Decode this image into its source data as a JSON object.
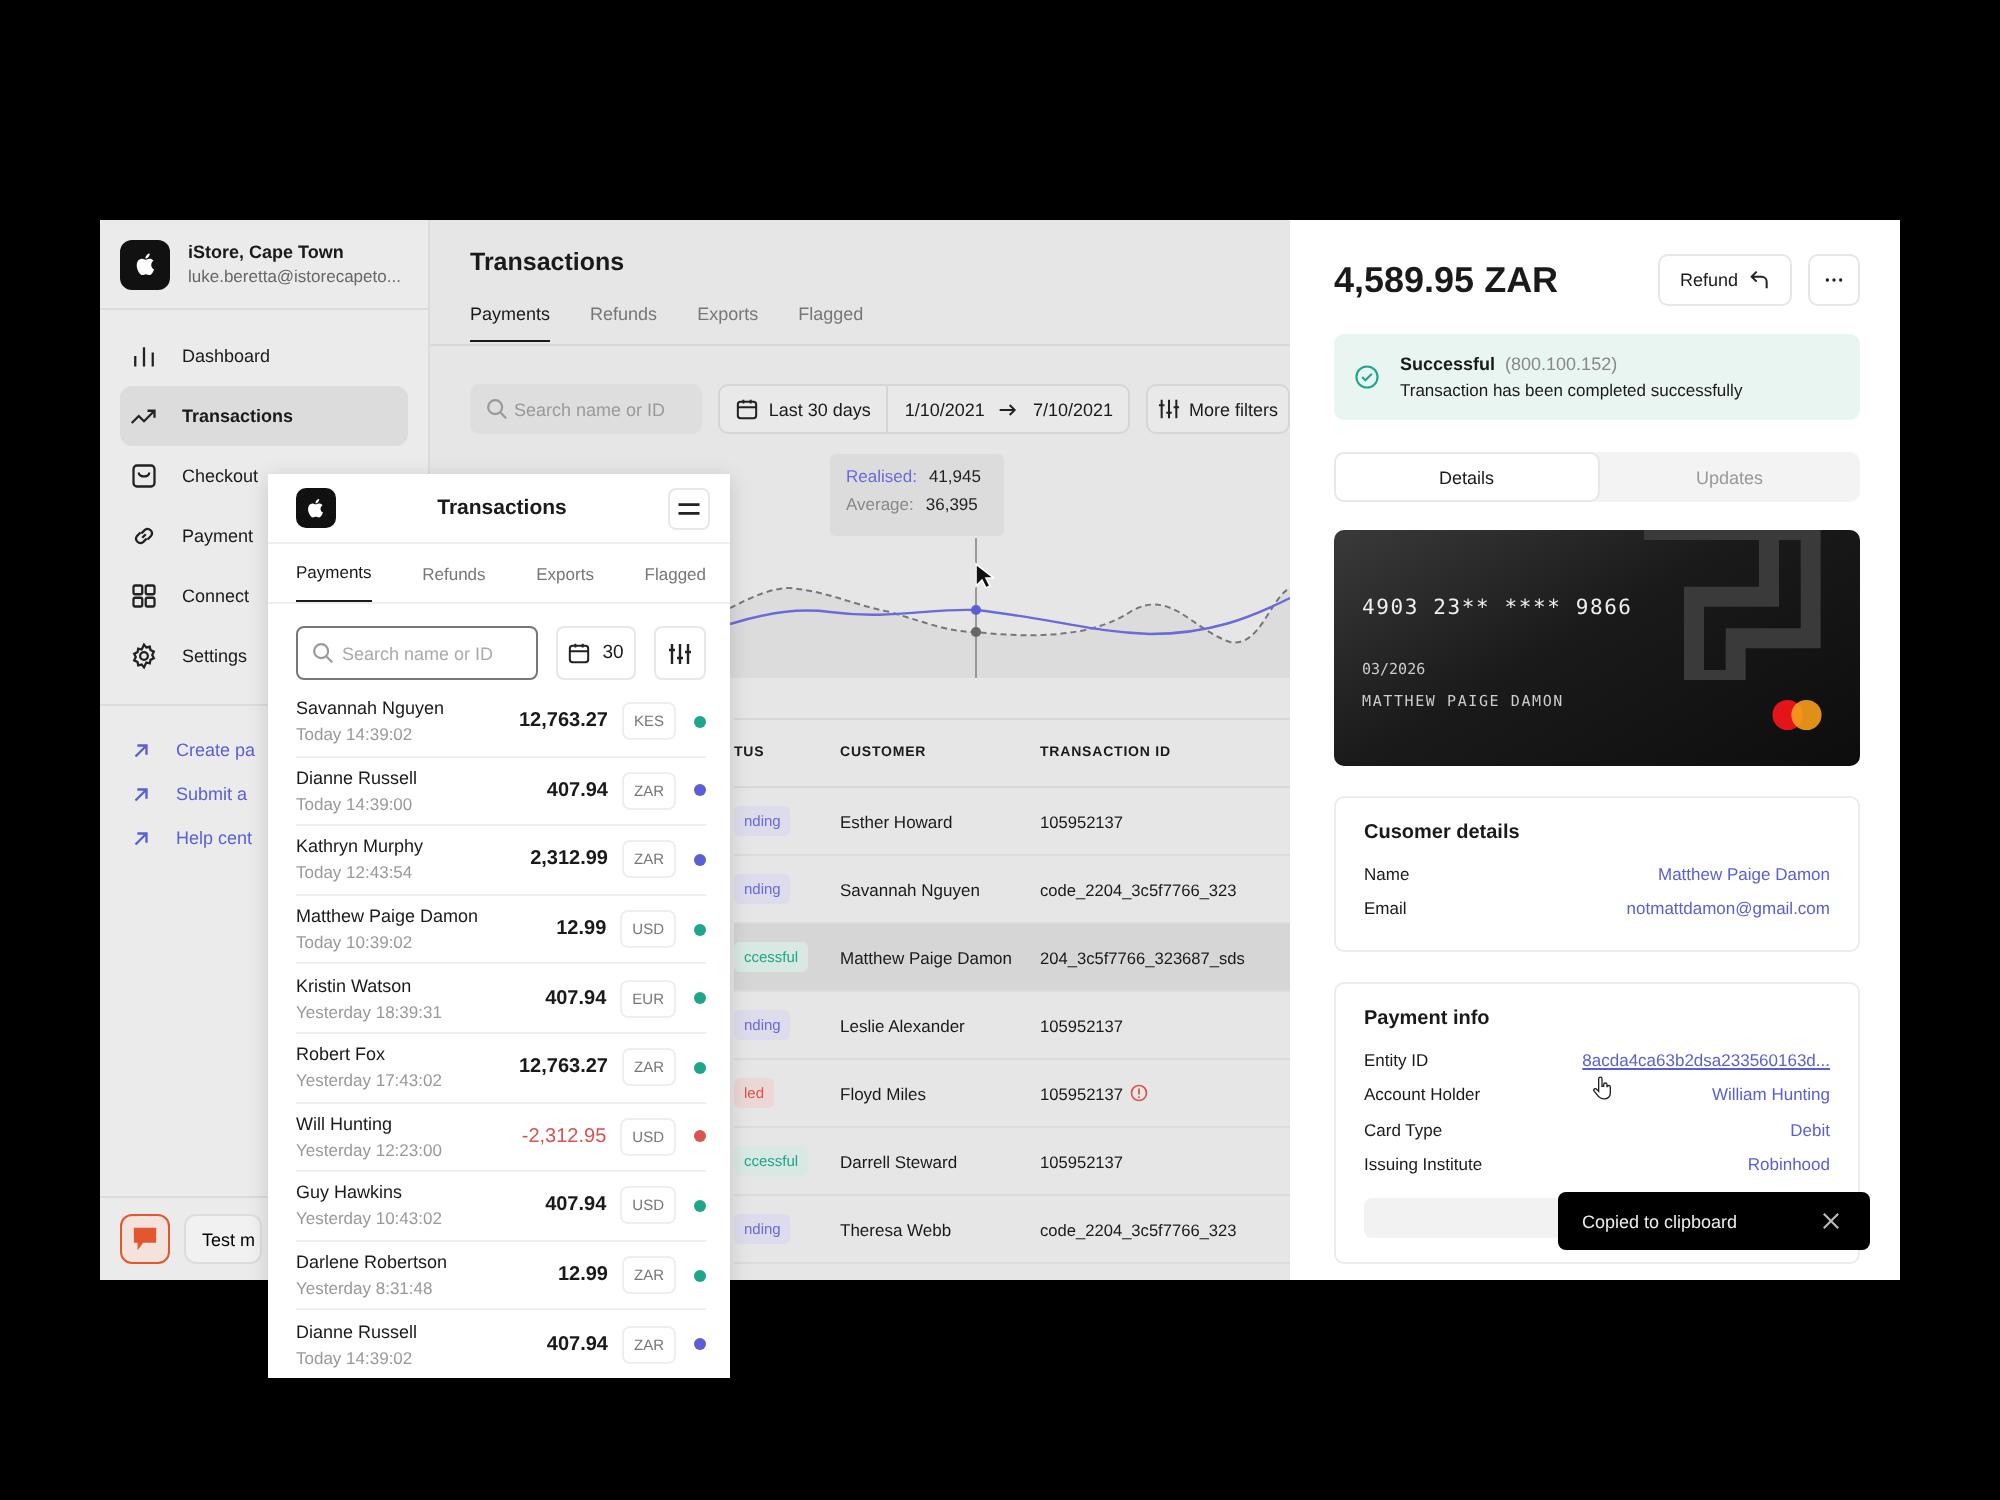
{
  "sidebar": {
    "store": "iStore, Cape Town",
    "email": "luke.beretta@istorecapeto...",
    "nav": [
      {
        "label": "Dashboard",
        "selected": false
      },
      {
        "label": "Transactions",
        "selected": true
      },
      {
        "label": "Checkout",
        "selected": false
      },
      {
        "label": "Payment",
        "selected": false
      },
      {
        "label": "Connect",
        "selected": false
      },
      {
        "label": "Settings",
        "selected": false
      }
    ],
    "links": [
      "Create pa",
      "Submit a",
      "Help cent"
    ],
    "test_button": "Test m"
  },
  "main": {
    "title": "Transactions",
    "tabs": [
      {
        "label": "Payments",
        "selected": true
      },
      {
        "label": "Refunds",
        "selected": false
      },
      {
        "label": "Exports",
        "selected": false
      },
      {
        "label": "Flagged",
        "selected": false
      }
    ],
    "search": {
      "placeholder": "Search name or ID"
    },
    "date_range": {
      "preset": "Last 30 days",
      "from": "1/10/2021",
      "to": "7/10/2021"
    },
    "more_filters": "More filters",
    "tooltip": [
      {
        "label": "Realised:",
        "value": "41,945",
        "kind": "realised"
      },
      {
        "label": "Average:",
        "value": "36,395",
        "kind": "average"
      }
    ],
    "table": {
      "columns": [
        "TUS",
        "CUSTOMER",
        "TRANSACTION ID"
      ],
      "rows": [
        {
          "status": "nding",
          "kind": "pending",
          "customer": "Esther Howard",
          "id": "105952137",
          "warning": false,
          "selected": false
        },
        {
          "status": "nding",
          "kind": "pending",
          "customer": "Savannah Nguyen",
          "id": "code_2204_3c5f7766_323",
          "warning": false,
          "selected": false
        },
        {
          "status": "ccessful",
          "kind": "successful",
          "customer": "Matthew Paige Damon",
          "id": "204_3c5f7766_323687_sds",
          "warning": false,
          "selected": true
        },
        {
          "status": "nding",
          "kind": "pending",
          "customer": "Leslie Alexander",
          "id": "105952137",
          "warning": false,
          "selected": false
        },
        {
          "status": "led",
          "kind": "failed",
          "customer": "Floyd Miles",
          "id": "105952137",
          "warning": true,
          "selected": false
        },
        {
          "status": "ccessful",
          "kind": "successful",
          "customer": "Darrell Steward",
          "id": "105952137",
          "warning": false,
          "selected": false
        },
        {
          "status": "nding",
          "kind": "pending",
          "customer": "Theresa Webb",
          "id": "code_2204_3c5f7766_323",
          "warning": false,
          "selected": false
        }
      ]
    }
  },
  "mobile": {
    "title": "Transactions",
    "tabs": [
      {
        "label": "Payments",
        "selected": true
      },
      {
        "label": "Refunds",
        "selected": false
      },
      {
        "label": "Exports",
        "selected": false
      },
      {
        "label": "Flagged",
        "selected": false
      }
    ],
    "search": {
      "placeholder": "Search name or ID"
    },
    "days": "30",
    "rows": [
      {
        "name": "Savannah Nguyen",
        "time": "Today 14:39:02",
        "amount": "12,763.27",
        "currency": "KES",
        "color": "#1fa58a",
        "negative": false
      },
      {
        "name": "Dianne Russell",
        "time": "Today 14:39:00",
        "amount": "407.94",
        "currency": "ZAR",
        "color": "#5b5fd6",
        "negative": false
      },
      {
        "name": "Kathryn Murphy",
        "time": "Today 12:43:54",
        "amount": "2,312.99",
        "currency": "ZAR",
        "color": "#5b5fd6",
        "negative": false
      },
      {
        "name": "Matthew Paige Damon",
        "time": "Today 10:39:02",
        "amount": "12.99",
        "currency": "USD",
        "color": "#1fa58a",
        "negative": false
      },
      {
        "name": "Kristin Watson",
        "time": "Yesterday 18:39:31",
        "amount": "407.94",
        "currency": "EUR",
        "color": "#1fa58a",
        "negative": false
      },
      {
        "name": "Robert Fox",
        "time": "Yesterday 17:43:02",
        "amount": "12,763.27",
        "currency": "ZAR",
        "color": "#1fa58a",
        "negative": false
      },
      {
        "name": "Will Hunting",
        "time": "Yesterday 12:23:00",
        "amount": "-2,312.95",
        "currency": "USD",
        "color": "#d9534f",
        "negative": true
      },
      {
        "name": "Guy Hawkins",
        "time": "Yesterday 10:43:02",
        "amount": "407.94",
        "currency": "USD",
        "color": "#1fa58a",
        "negative": false
      },
      {
        "name": "Darlene Robertson",
        "time": "Yesterday 8:31:48",
        "amount": "12.99",
        "currency": "ZAR",
        "color": "#1fa58a",
        "negative": false
      },
      {
        "name": "Dianne Russell",
        "time": "Today 14:39:02",
        "amount": "407.94",
        "currency": "ZAR",
        "color": "#5b5fd6",
        "negative": false
      }
    ]
  },
  "detail": {
    "amount": "4,589.95 ZAR",
    "refund_button": "Refund",
    "banner": {
      "title": "Successful",
      "code": "(800.100.152)",
      "message": "Transaction has been completed successfully"
    },
    "tabs": [
      {
        "label": "Details",
        "selected": true
      },
      {
        "label": "Updates",
        "selected": false
      }
    ],
    "card": {
      "number": "4903 23** **** 9866",
      "expiry": "03/2026",
      "holder": "MATTHEW PAIGE DAMON"
    },
    "customer": {
      "title": "Cusomer details",
      "rows": [
        {
          "label": "Name",
          "value": "Matthew Paige Damon",
          "underlined": false
        },
        {
          "label": "Email",
          "value": "notmattdamon@gmail.com",
          "underlined": false
        }
      ]
    },
    "payment": {
      "title": "Payment info",
      "rows": [
        {
          "label": "Entity ID",
          "value": "8acda4ca63b2dsa233560163d...",
          "underlined": true
        },
        {
          "label": "Account Holder",
          "value": "William Hunting",
          "underlined": false
        },
        {
          "label": "Card Type",
          "value": "Debit",
          "underlined": false
        },
        {
          "label": "Issuing Institute",
          "value": "Robinhood",
          "underlined": false
        }
      ]
    }
  },
  "toast": {
    "text": "Copied to clipboard"
  }
}
